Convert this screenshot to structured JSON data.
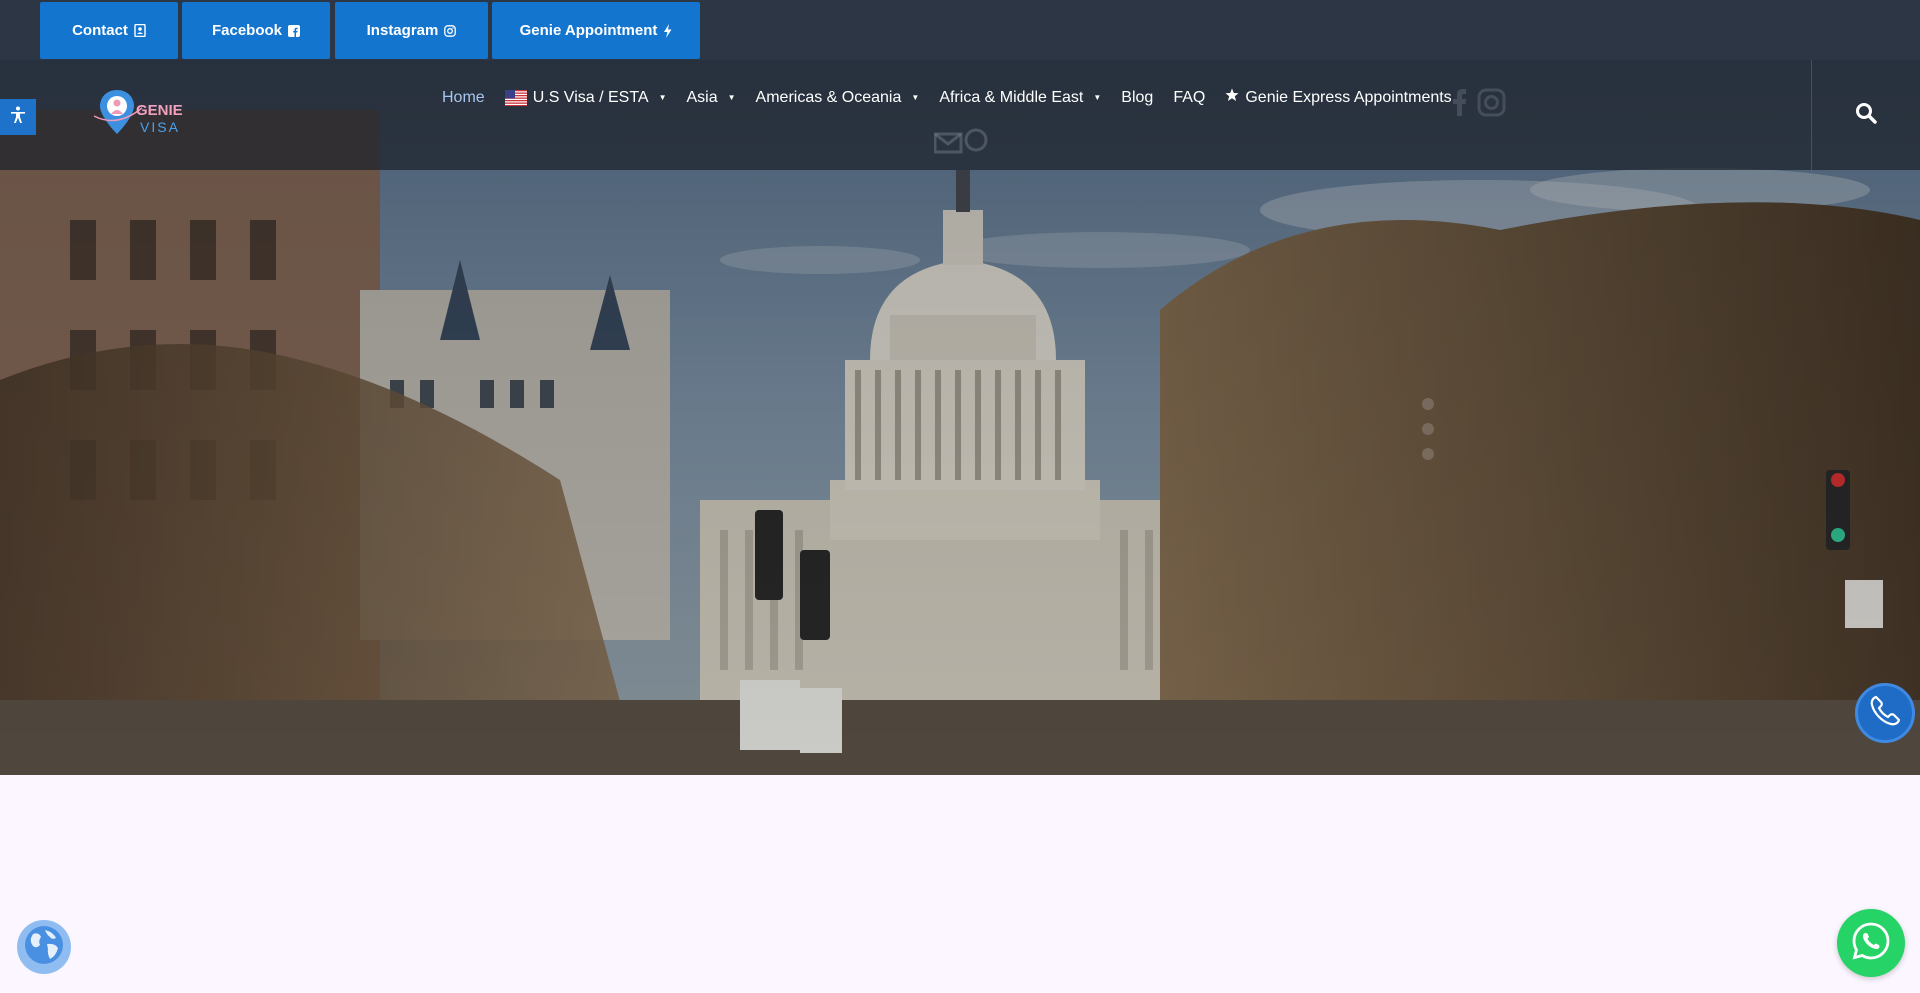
{
  "topbar": {
    "buttons": [
      {
        "label": "Contact",
        "icon": "address-book-icon"
      },
      {
        "label": "Facebook",
        "icon": "facebook-square-icon"
      },
      {
        "label": "Instagram",
        "icon": "instagram-icon"
      },
      {
        "label": "Genie Appointment",
        "icon": "bolt-icon"
      }
    ]
  },
  "header": {
    "logo": {
      "line1": "GENIE",
      "line2": "VISA"
    },
    "nav": [
      {
        "label": "Home",
        "active": true,
        "has_dropdown": false
      },
      {
        "label": "U.S Visa / ESTA",
        "icon": "us-flag-icon",
        "has_dropdown": true
      },
      {
        "label": "Asia",
        "has_dropdown": true
      },
      {
        "label": "Americas & Oceania",
        "has_dropdown": true
      },
      {
        "label": "Africa & Middle East",
        "has_dropdown": true
      },
      {
        "label": "Blog",
        "has_dropdown": false
      },
      {
        "label": "FAQ",
        "has_dropdown": false
      },
      {
        "label": "Genie Express Appointments",
        "icon": "star-icon",
        "has_dropdown": false
      }
    ],
    "search_icon": "search-icon"
  },
  "hero": {
    "image": "US Capitol building down a tree-lined avenue",
    "slider_dots": 3
  },
  "floating": {
    "accessibility_icon": "accessibility-icon",
    "call_icon": "phone-icon",
    "whatsapp_icon": "whatsapp-icon",
    "language_icon": "globe-icon"
  },
  "colors": {
    "topbar_bg": "#2c3644",
    "button_blue": "#1475cf",
    "nav_active": "#a7c6f0",
    "page_bg": "#fbf6ff",
    "whatsapp": "#25d366"
  }
}
